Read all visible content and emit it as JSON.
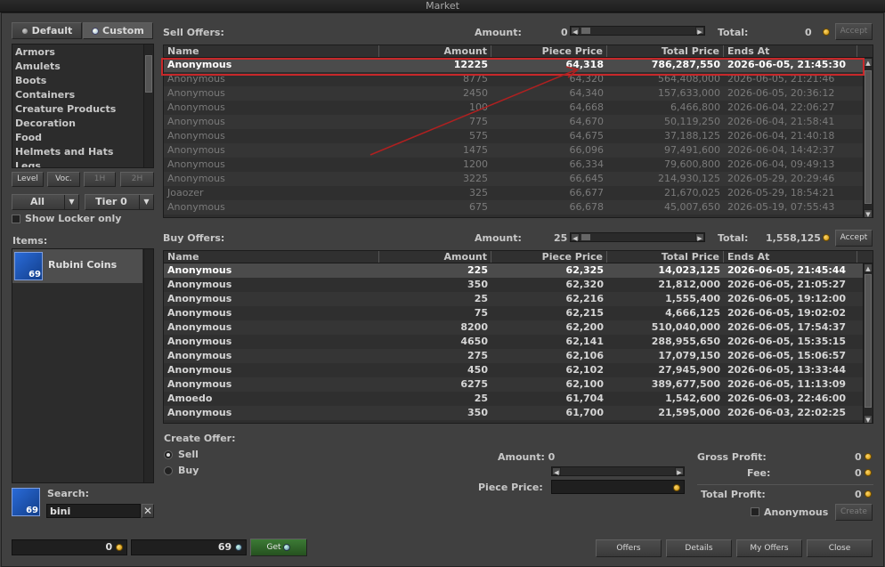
{
  "window": {
    "title": "Market"
  },
  "tabs": {
    "default_label": "Default",
    "custom_label": "Custom"
  },
  "categories": [
    "Armors",
    "Amulets",
    "Boots",
    "Containers",
    "Creature Products",
    "Decoration",
    "Food",
    "Helmets and Hats",
    "Legs"
  ],
  "filters": {
    "level": "Level",
    "voc": "Voc.",
    "h1": "1H",
    "h2": "2H",
    "all": "All",
    "tier": "Tier 0",
    "show_locker": "Show Locker only"
  },
  "items": {
    "label": "Items:",
    "list": [
      {
        "name": "Rubini Coins",
        "count": "69"
      }
    ]
  },
  "search": {
    "label": "Search:",
    "value": "bini",
    "icon_count": "69"
  },
  "bottom": {
    "gold": "0",
    "coins": "69",
    "get": "Get"
  },
  "sell": {
    "label": "Sell Offers:",
    "amount_label": "Amount:",
    "amount": "0",
    "total_label": "Total:",
    "total": "0",
    "accept": "Accept"
  },
  "buy": {
    "label": "Buy Offers:",
    "amount_label": "Amount:",
    "amount": "25",
    "total_label": "Total:",
    "total": "1,558,125",
    "accept": "Accept"
  },
  "columns": [
    "Name",
    "Amount",
    "Piece Price",
    "Total Price",
    "Ends At"
  ],
  "sell_rows": [
    [
      "Anonymous",
      "12225",
      "64,318",
      "786,287,550",
      "2026-06-05, 21:45:30"
    ],
    [
      "Anonymous",
      "8775",
      "64,320",
      "564,408,000",
      "2026-06-05, 21:21:46"
    ],
    [
      "Anonymous",
      "2450",
      "64,340",
      "157,633,000",
      "2026-06-05, 20:36:12"
    ],
    [
      "Anonymous",
      "100",
      "64,668",
      "6,466,800",
      "2026-06-04, 22:06:27"
    ],
    [
      "Anonymous",
      "775",
      "64,670",
      "50,119,250",
      "2026-06-04, 21:58:41"
    ],
    [
      "Anonymous",
      "575",
      "64,675",
      "37,188,125",
      "2026-06-04, 21:40:18"
    ],
    [
      "Anonymous",
      "1475",
      "66,096",
      "97,491,600",
      "2026-06-04, 14:42:37"
    ],
    [
      "Anonymous",
      "1200",
      "66,334",
      "79,600,800",
      "2026-06-04, 09:49:13"
    ],
    [
      "Anonymous",
      "3225",
      "66,645",
      "214,930,125",
      "2026-05-29, 20:29:46"
    ],
    [
      "Joaozer",
      "325",
      "66,677",
      "21,670,025",
      "2026-05-29, 18:54:21"
    ],
    [
      "Anonymous",
      "675",
      "66,678",
      "45,007,650",
      "2026-05-19, 07:55:43"
    ]
  ],
  "buy_rows": [
    [
      "Anonymous",
      "225",
      "62,325",
      "14,023,125",
      "2026-06-05, 21:45:44"
    ],
    [
      "Anonymous",
      "350",
      "62,320",
      "21,812,000",
      "2026-06-05, 21:05:27"
    ],
    [
      "Anonymous",
      "25",
      "62,216",
      "1,555,400",
      "2026-06-05, 19:12:00"
    ],
    [
      "Anonymous",
      "75",
      "62,215",
      "4,666,125",
      "2026-06-05, 19:02:02"
    ],
    [
      "Anonymous",
      "8200",
      "62,200",
      "510,040,000",
      "2026-06-05, 17:54:37"
    ],
    [
      "Anonymous",
      "4650",
      "62,141",
      "288,955,650",
      "2026-06-05, 15:35:15"
    ],
    [
      "Anonymous",
      "275",
      "62,106",
      "17,079,150",
      "2026-06-05, 15:06:57"
    ],
    [
      "Anonymous",
      "450",
      "62,102",
      "27,945,900",
      "2026-06-05, 13:33:44"
    ],
    [
      "Anonymous",
      "6275",
      "62,100",
      "389,677,500",
      "2026-06-05, 11:13:09"
    ],
    [
      "Amoedo",
      "25",
      "61,704",
      "1,542,600",
      "2026-06-03, 22:46:00"
    ],
    [
      "Anonymous",
      "350",
      "61,700",
      "21,595,000",
      "2026-06-03, 22:02:25"
    ]
  ],
  "create": {
    "label": "Create Offer:",
    "sell": "Sell",
    "buy": "Buy",
    "amount_label": "Amount: 0",
    "piece_price_label": "Piece Price:",
    "gross_label": "Gross Profit:",
    "gross": "0",
    "fee_label": "Fee:",
    "fee": "0",
    "total_label": "Total Profit:",
    "total": "0",
    "anonymous": "Anonymous",
    "create_btn": "Create"
  },
  "footer_buttons": {
    "offers": "Offers",
    "details": "Details",
    "my_offers": "My Offers",
    "close": "Close"
  },
  "colors": {
    "highlight": "#c8282a",
    "gold": "#f0b020"
  }
}
